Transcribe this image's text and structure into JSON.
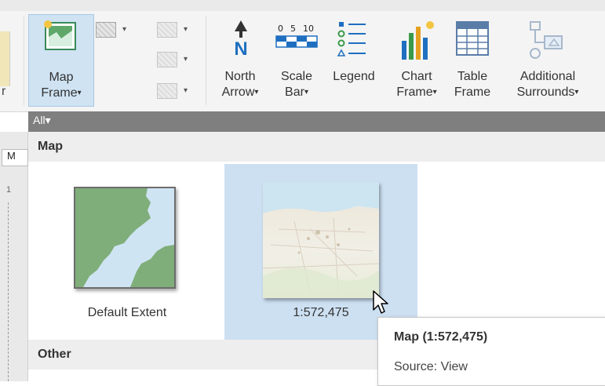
{
  "ribbon": {
    "map_frame": {
      "line1": "Map",
      "line2": "Frame",
      "caret": "▾"
    },
    "north_arrow": {
      "line1": "North",
      "line2": "Arrow",
      "caret": "▾",
      "icon": "north-arrow-icon",
      "letter": "N"
    },
    "scale_bar": {
      "line1": "Scale",
      "line2": "Bar",
      "caret": "▾",
      "icon": "scale-bar-icon",
      "ticks": [
        "0",
        "5",
        "10"
      ]
    },
    "legend": {
      "line1": "Legend",
      "icon": "legend-icon"
    },
    "chart_frame": {
      "line1": "Chart",
      "line2": "Frame",
      "caret": "▾",
      "icon": "chart-frame-icon"
    },
    "table_frame": {
      "line1": "Table",
      "line2": "Frame",
      "icon": "table-frame-icon"
    },
    "additional_surrounds": {
      "line1": "Additional",
      "line2": "Surrounds",
      "caret": "▾",
      "icon": "additional-surrounds-icon"
    },
    "left_fragment": "r"
  },
  "gallery": {
    "filter": "All",
    "filter_caret": "▾",
    "groups": {
      "map": "Map",
      "other": "Other"
    },
    "tiles": [
      {
        "label": "Default Extent",
        "icon": "default-extent-thumbnail"
      },
      {
        "label": "1:572,475",
        "icon": "map-view-thumbnail",
        "selected": true
      }
    ]
  },
  "document": {
    "tab_label": "M",
    "ruler_mark": "1"
  },
  "tooltip": {
    "title": "Map (1:572,475)",
    "source": "Source: View"
  },
  "colors": {
    "selection": "#cde0f2",
    "filter_bar": "#7f7f7f",
    "group_header": "#eeeeee",
    "map_green": "#7fae7a"
  }
}
